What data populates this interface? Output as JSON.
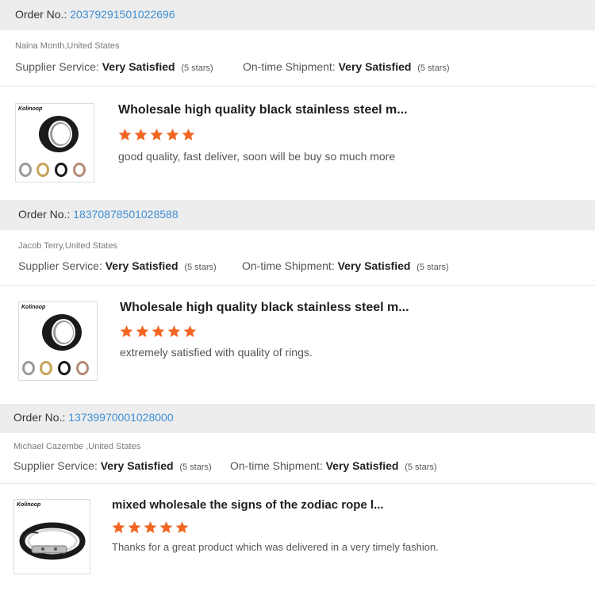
{
  "order_label": "Order No.:",
  "supplier_label": "Supplier Service:",
  "shipment_label": "On-time Shipment:",
  "star_color": "#f26522",
  "link_color": "#3d8fd6",
  "reviews": [
    {
      "order_no": "20379291501022696",
      "reviewer": "Naina Month,United States",
      "supplier_value": "Very Satisfied",
      "supplier_stars": "(5 stars)",
      "shipment_value": "Very Satisfied",
      "shipment_stars": "(5 stars)",
      "product_title": "Wholesale high quality black stainless steel m...",
      "rating": 5,
      "brand": "Kolinoop",
      "product_icon": "black-ring-product-image",
      "comment": "good quality, fast deliver, soon will be buy so much more"
    },
    {
      "order_no": "18370878501028588",
      "reviewer": "Jacob Terry,United States",
      "supplier_value": "Very Satisfied",
      "supplier_stars": "(5 stars)",
      "shipment_value": "Very Satisfied",
      "shipment_stars": "(5 stars)",
      "product_title": "Wholesale high quality black stainless steel m...",
      "rating": 5,
      "brand": "Kolinoop",
      "product_icon": "black-ring-product-image",
      "comment": "extremely satisfied with quality of rings."
    },
    {
      "order_no": "13739970001028000",
      "reviewer": "Michael Cazembe ,United States",
      "supplier_value": "Very Satisfied",
      "supplier_stars": "(5 stars)",
      "shipment_value": "Very Satisfied",
      "shipment_stars": "(5 stars)",
      "product_title": "mixed wholesale the signs of the zodiac rope l...",
      "rating": 5,
      "brand": "Kolinoop",
      "product_icon": "zodiac-bracelet-product-image",
      "comment": "Thanks for a great product which was delivered in a very timely fashion."
    }
  ]
}
